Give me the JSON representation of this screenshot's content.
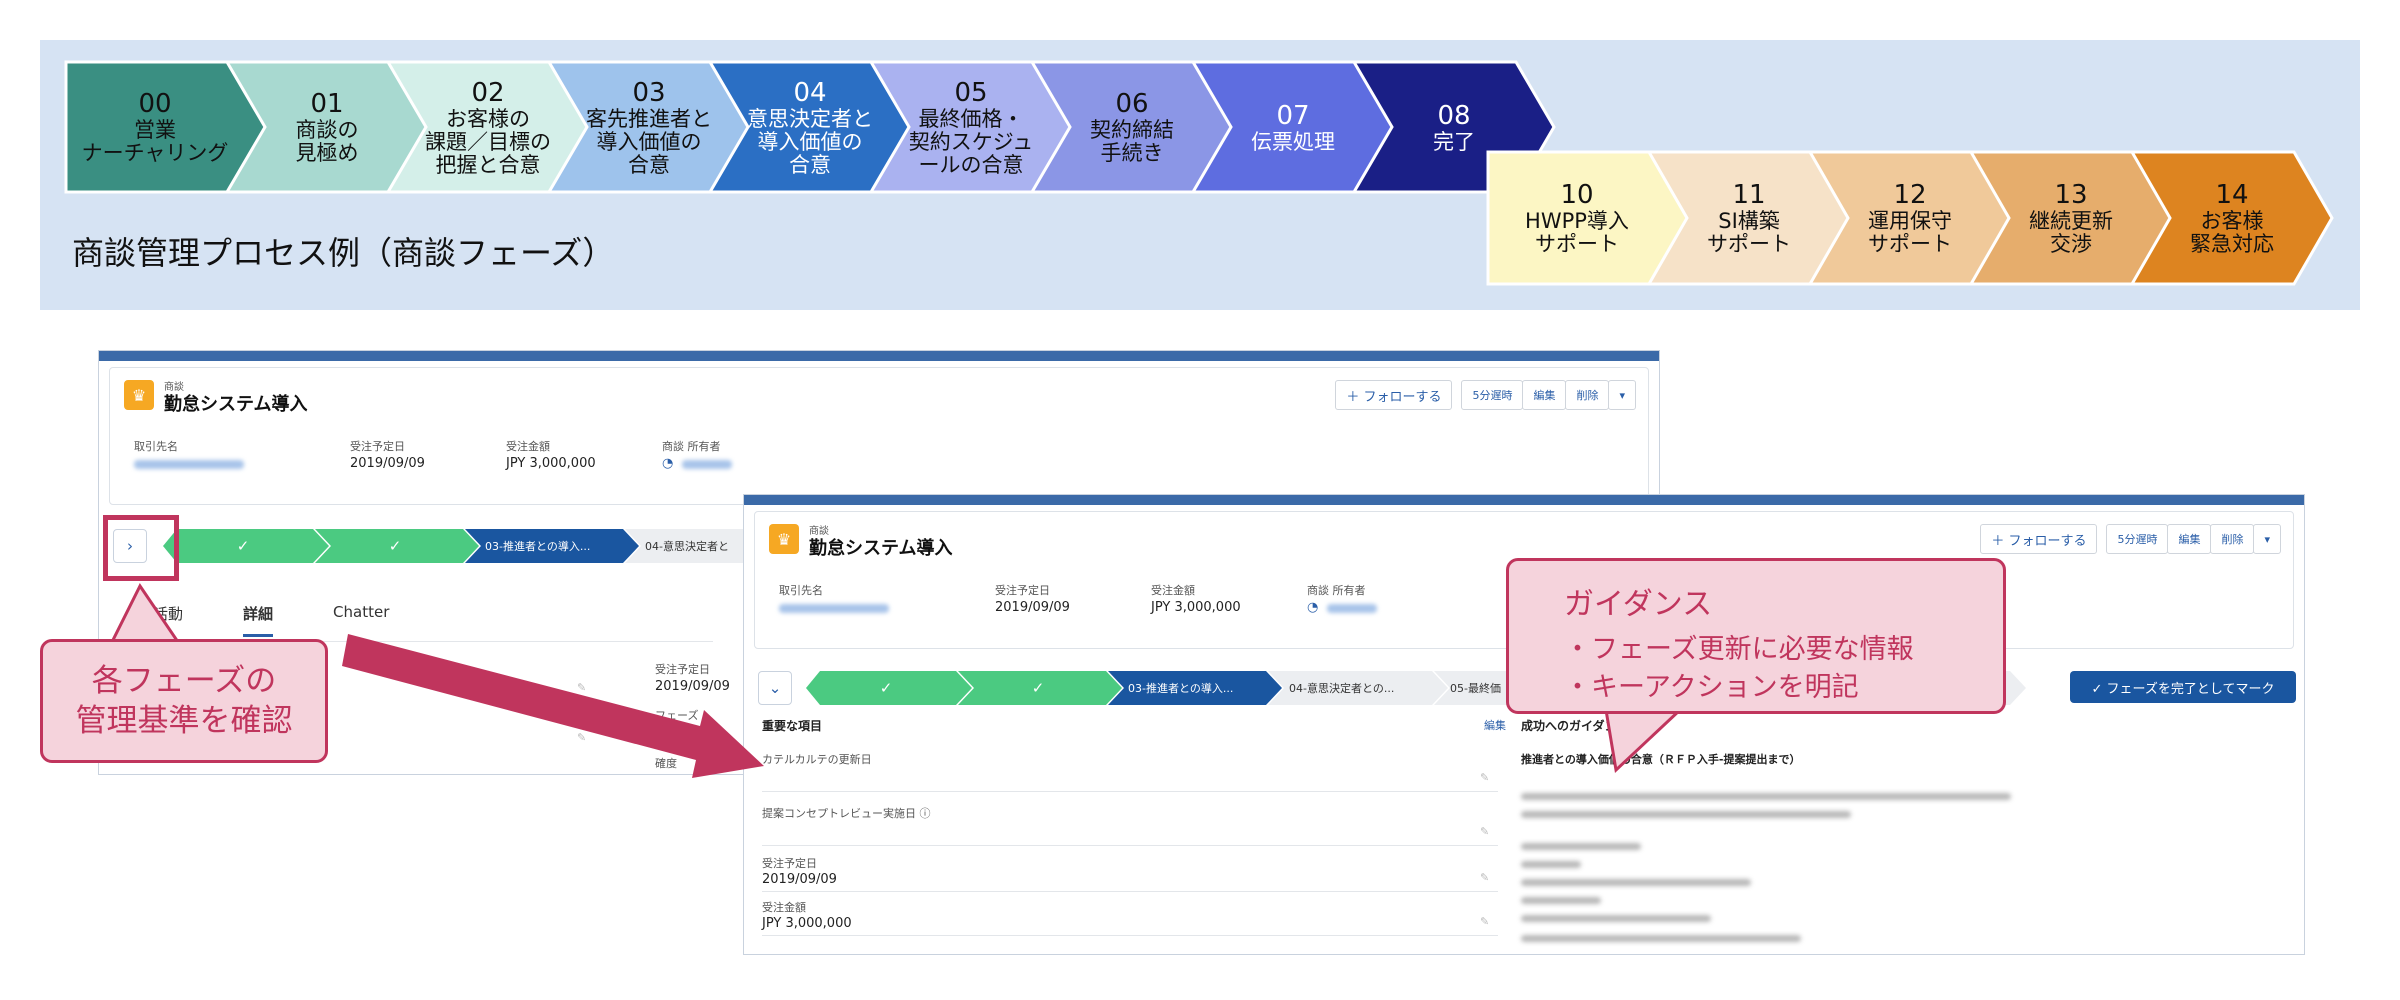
{
  "phases_top": [
    {
      "num": "00",
      "lines": [
        "営業",
        "ナーチャリング"
      ],
      "bg": "#3a8f82",
      "fg": "#111111"
    },
    {
      "num": "01",
      "lines": [
        "商談の",
        "見極め"
      ],
      "bg": "#a8d9d0",
      "fg": "#111111"
    },
    {
      "num": "02",
      "lines": [
        "お客様の",
        "課題／目標の",
        "把握と合意"
      ],
      "bg": "#d4efe9",
      "fg": "#111111"
    },
    {
      "num": "03",
      "lines": [
        "客先推進者と",
        "導入価値の",
        "合意"
      ],
      "bg": "#9ec3ec",
      "fg": "#111111"
    },
    {
      "num": "04",
      "lines": [
        "意思決定者と",
        "導入価値の",
        "合意"
      ],
      "bg": "#2b6fc4",
      "fg": "#ffffff"
    },
    {
      "num": "05",
      "lines": [
        "最終価格・",
        "契約スケジュ",
        "ールの合意"
      ],
      "bg": "#aab2f0",
      "fg": "#111111"
    },
    {
      "num": "06",
      "lines": [
        "契約締結",
        "手続き"
      ],
      "bg": "#8b96e6",
      "fg": "#111111"
    },
    {
      "num": "07",
      "lines": [
        "伝票処理"
      ],
      "bg": "#5e6de0",
      "fg": "#ffffff"
    },
    {
      "num": "08",
      "lines": [
        "完了"
      ],
      "bg": "#1a1f86",
      "fg": "#ffffff"
    }
  ],
  "phases_bottom": [
    {
      "num": "10",
      "lines": [
        "HWPP導入",
        "サポート"
      ],
      "bg": "#fcf6c4",
      "fg": "#111111"
    },
    {
      "num": "11",
      "lines": [
        "SI構築",
        "サポート"
      ],
      "bg": "#f6e2c8",
      "fg": "#111111"
    },
    {
      "num": "12",
      "lines": [
        "運用保守",
        "サポート"
      ],
      "bg": "#f0c99a",
      "fg": "#111111"
    },
    {
      "num": "13",
      "lines": [
        "継続更新",
        "交渉"
      ],
      "bg": "#e6ad6c",
      "fg": "#111111"
    },
    {
      "num": "14",
      "lines": [
        "お客様",
        "緊急対応"
      ],
      "bg": "#dd8420",
      "fg": "#111111"
    }
  ],
  "banner_title": "商談管理プロセス例（商談フェーズ）",
  "record": {
    "object_label": "商談",
    "title": "勤怠システム導入",
    "follow_button": "＋ フォローする",
    "btn_5min": "5分遅時",
    "btn_edit": "編集",
    "btn_delete": "削除",
    "fields": [
      {
        "label": "取引先名",
        "value": ""
      },
      {
        "label": "受注予定日",
        "value": "2019/09/09"
      },
      {
        "label": "受注金額",
        "value": "JPY 3,000,000"
      },
      {
        "label": "商談 所有者",
        "value": ""
      }
    ]
  },
  "path_back": {
    "step3": "03-推進者との導入...",
    "step4": "04-意思決定者と"
  },
  "tabs_back": [
    "活動",
    "詳細",
    "Chatter"
  ],
  "back_fields": {
    "label1": "受注予定日",
    "val1": "2019/09/09",
    "label2": "フェーズ",
    "label3": "確度"
  },
  "path_front": {
    "step3": "03-推進者との導入...",
    "step4": "04-意思決定者との...",
    "step5": "05-最終価",
    "mark_button": "✓ フェーズを完了としてマーク"
  },
  "key_fields": {
    "section": "重要な項目",
    "edit": "編集",
    "items": [
      {
        "label": "カテルカルテの更新日",
        "value": ""
      },
      {
        "label": "提案コンセプトレビュー実施日 ⓘ",
        "value": ""
      },
      {
        "label": "受注予定日",
        "value": "2019/09/09"
      },
      {
        "label": "受注金額",
        "value": "JPY 3,000,000"
      }
    ]
  },
  "guidance": {
    "title": "成功へのガイダンス",
    "subtitle": "推進者との導入価値の合意（ＲＦＰ入手-提案提出まで）"
  },
  "callout_left": {
    "line1": "各フェーズの",
    "line2": "管理基準を確認"
  },
  "callout_right": {
    "title": "ガイダンス",
    "line1": "・フェーズ更新に必要な情報",
    "line2": "・キーアクションを明記"
  },
  "colors": {
    "accent_red": "#c0355d",
    "callout_fill": "#f5d3dc",
    "path_green": "#4bca81",
    "path_blue": "#1a56a0",
    "banner_bg": "#d6e3f3"
  }
}
